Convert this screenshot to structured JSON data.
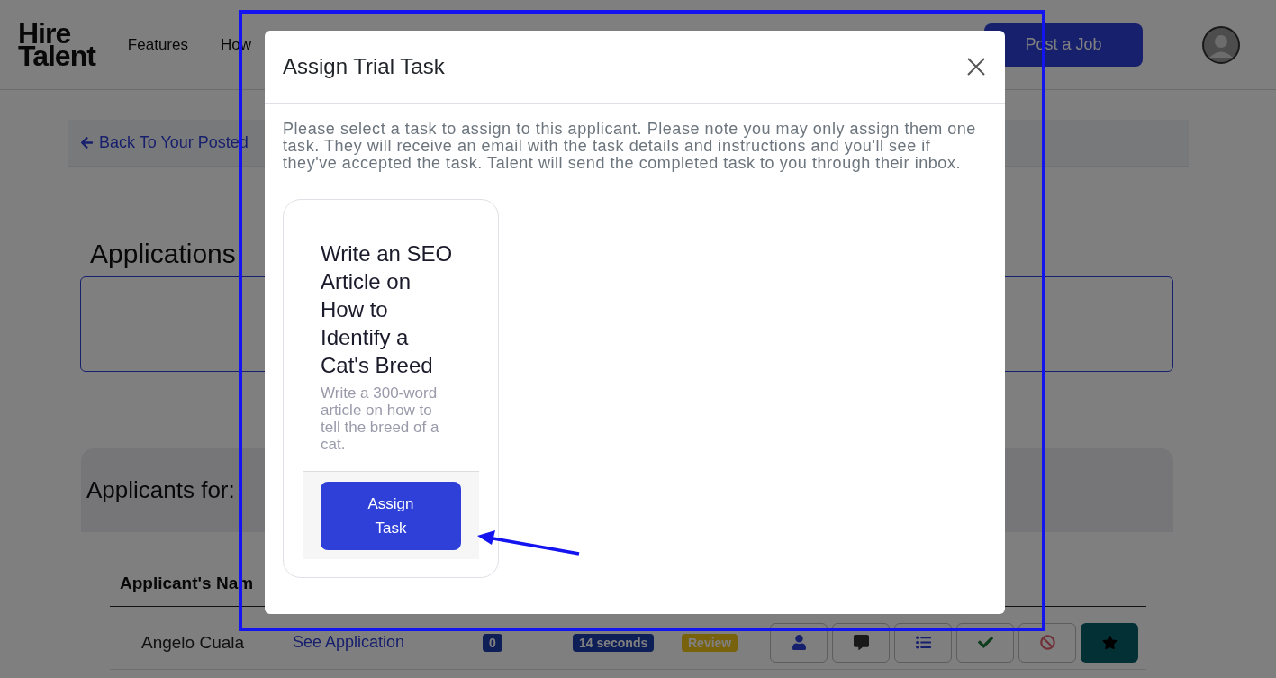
{
  "header": {
    "logo": [
      "Hire",
      "Talent"
    ],
    "nav": [
      "Features",
      "How"
    ],
    "post_button": "Post a Job"
  },
  "back_link": "Back To Your Posted",
  "applications_title": "Applications",
  "applicants_card": {
    "title": "Applicants for:",
    "columns": [
      "Applicant's Nam"
    ],
    "rows": [
      {
        "name": "Angelo Cuala",
        "link": "See Application",
        "count": "0",
        "time": "14 seconds",
        "status": "Review",
        "actions": [
          {
            "kind": "user",
            "selected": false
          },
          {
            "kind": "comment",
            "selected": false
          },
          {
            "kind": "list",
            "selected": false
          },
          {
            "kind": "check",
            "selected": false
          },
          {
            "kind": "ban",
            "selected": false
          },
          {
            "kind": "star",
            "selected": true
          }
        ]
      }
    ]
  },
  "modal": {
    "title": "Assign Trial Task",
    "description": "Please select a task to assign to this applicant. Please note you may only assign them one task. They will receive an email with the task details and instructions and you'll see if they've accepted the task. Talent will send the completed task to you through their inbox.",
    "tasks": [
      {
        "title": "Write an SEO Article on How to Identify a Cat's Breed",
        "description": "Write a 300-word article on how to tell the breed of a cat.",
        "button": "Assign Task"
      }
    ]
  }
}
